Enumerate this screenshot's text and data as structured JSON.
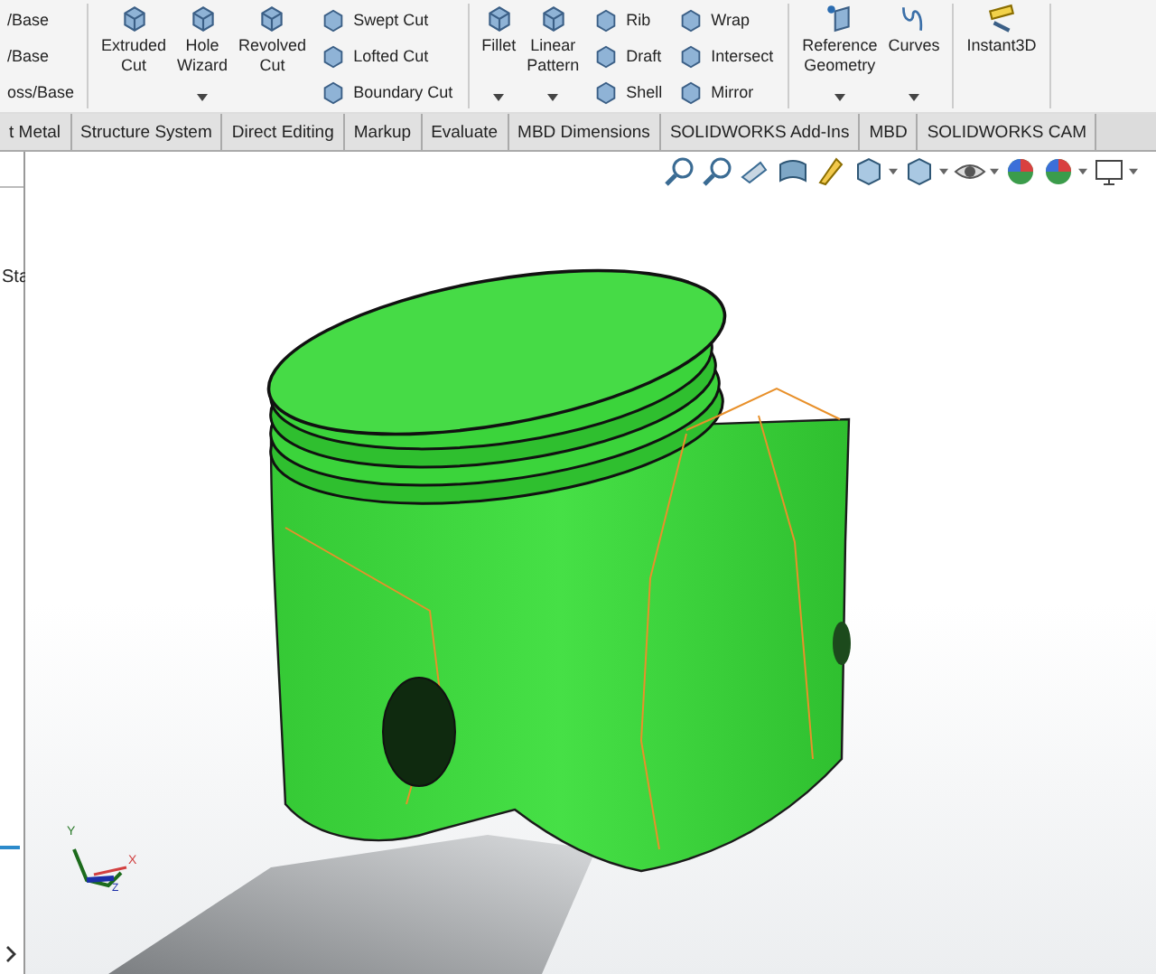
{
  "ribbon": {
    "cut_column": [
      "/Base",
      "/Base",
      "oss/Base"
    ],
    "groups": [
      {
        "items": [
          {
            "kind": "feature",
            "label": "Extruded Cut",
            "dropdown": false
          },
          {
            "kind": "feature",
            "label": "Hole Wizard",
            "dropdown": true
          },
          {
            "kind": "feature",
            "label": "Revolved Cut",
            "dropdown": false
          },
          {
            "kind": "column",
            "labels": [
              "Swept Cut",
              "Lofted Cut",
              "Boundary Cut"
            ]
          }
        ]
      },
      {
        "items": [
          {
            "kind": "feature",
            "label": "Fillet",
            "dropdown": true
          },
          {
            "kind": "feature",
            "label": "Linear Pattern",
            "dropdown": true
          },
          {
            "kind": "column",
            "labels": [
              "Rib",
              "Draft",
              "Shell"
            ]
          },
          {
            "kind": "column",
            "labels": [
              "Wrap",
              "Intersect",
              "Mirror"
            ]
          }
        ]
      },
      {
        "items": [
          {
            "kind": "plane",
            "label": "Reference Geometry",
            "dropdown": true
          },
          {
            "kind": "curve",
            "label": "Curves",
            "dropdown": true
          }
        ]
      },
      {
        "items": [
          {
            "kind": "ruler",
            "label": "Instant3D",
            "dropdown": false
          }
        ]
      }
    ]
  },
  "tabs": [
    {
      "label": "t Metal",
      "selected": false
    },
    {
      "label": "Structure System",
      "selected": false
    },
    {
      "label": "Direct Editing",
      "selected": false
    },
    {
      "label": "Markup",
      "selected": false
    },
    {
      "label": "Evaluate",
      "selected": false
    },
    {
      "label": "MBD Dimensions",
      "selected": false
    },
    {
      "label": "SOLIDWORKS Add-Ins",
      "selected": false
    },
    {
      "label": "MBD",
      "selected": false
    },
    {
      "label": "SOLIDWORKS CAM",
      "selected": false
    }
  ],
  "side_panel": {
    "label": "Sta"
  },
  "view_toolbar": [
    {
      "kind": "zoom-fit",
      "dropdown": false
    },
    {
      "kind": "zoom-area",
      "dropdown": false
    },
    {
      "kind": "previous",
      "dropdown": false
    },
    {
      "kind": "section",
      "dropdown": false
    },
    {
      "kind": "annotation",
      "dropdown": false
    },
    {
      "kind": "orientation",
      "dropdown": true
    },
    {
      "kind": "display",
      "dropdown": true
    },
    {
      "kind": "hide",
      "dropdown": true
    },
    {
      "kind": "appearance",
      "dropdown": false
    },
    {
      "kind": "scene",
      "dropdown": true
    },
    {
      "kind": "monitor",
      "dropdown": true
    }
  ],
  "triad": {
    "x": "X",
    "y": "Y",
    "z": "Z"
  }
}
